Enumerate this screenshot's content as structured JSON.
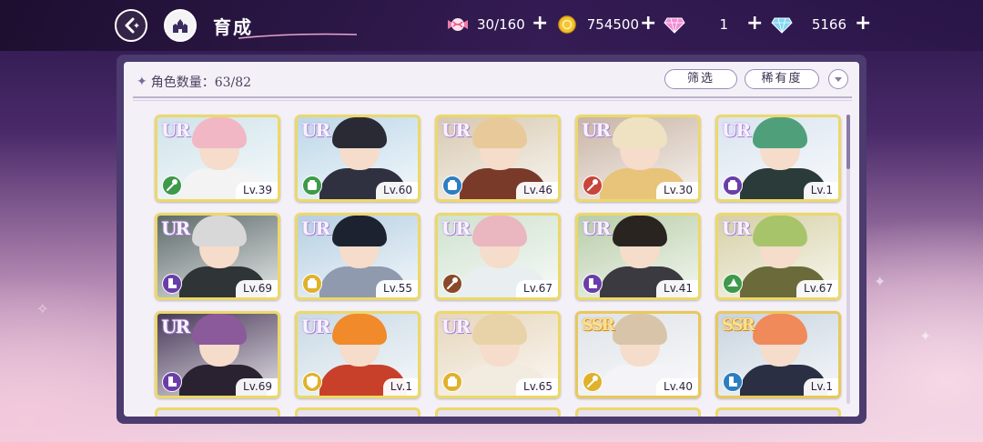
{
  "header": {
    "title": "育成",
    "resources": [
      {
        "icon": "candy-icon",
        "value": "30/160"
      },
      {
        "icon": "gold-coin-icon",
        "value": "754500"
      },
      {
        "icon": "pink-diamond-icon",
        "value": "1"
      },
      {
        "icon": "blue-diamond-icon",
        "value": "5166"
      }
    ]
  },
  "panel": {
    "count_label": "角色数量",
    "count_value": "：63/82",
    "filter_label": "筛选",
    "rarity_sort_label": "稀有度"
  },
  "cards": [
    {
      "rarity": "UR",
      "level": "Lv.39",
      "type_color": "#3e9a4a",
      "type_icon": "wand",
      "hair": "#f2b7c4",
      "bg": "#cfe3ea",
      "body": "#f3f3f3"
    },
    {
      "rarity": "UR",
      "level": "Lv.60",
      "type_color": "#3e9a4a",
      "type_icon": "fist",
      "hair": "#2a2a34",
      "bg": "#bcd7e8",
      "body": "#2f3140"
    },
    {
      "rarity": "UR",
      "level": "Lv.46",
      "type_color": "#2c7ec2",
      "type_icon": "fist",
      "hair": "#e8c99a",
      "bg": "#d7c9b0",
      "body": "#7a3a2a"
    },
    {
      "rarity": "UR",
      "level": "Lv.30",
      "type_color": "#c8453a",
      "type_icon": "wand",
      "hair": "#efe2c2",
      "bg": "#c9b4a4",
      "body": "#e7c47a"
    },
    {
      "rarity": "UR",
      "level": "Lv.1",
      "type_color": "#6a3ea8",
      "type_icon": "fist",
      "hair": "#4fa07a",
      "bg": "#d9e4ef",
      "body": "#2b3b3a"
    },
    {
      "rarity": "UR",
      "level": "Lv.69",
      "type_color": "#6a3ea8",
      "type_icon": "boot",
      "hair": "#d8d8d8",
      "bg": "#5d6a6a",
      "body": "#2f3436"
    },
    {
      "rarity": "UR",
      "level": "Lv.55",
      "type_color": "#e0b12a",
      "type_icon": "fist",
      "hair": "#1d2230",
      "bg": "#b5cfe2",
      "body": "#8f9aae"
    },
    {
      "rarity": "UR",
      "level": "Lv.67",
      "type_color": "#8a4a2a",
      "type_icon": "wand",
      "hair": "#eab6bf",
      "bg": "#cfe2cf",
      "body": "#e9eef0"
    },
    {
      "rarity": "UR",
      "level": "Lv.41",
      "type_color": "#6a3ea8",
      "type_icon": "boot",
      "hair": "#2a2420",
      "bg": "#b8cda8",
      "body": "#3a3a40"
    },
    {
      "rarity": "UR",
      "level": "Lv.67",
      "type_color": "#3e9a4a",
      "type_icon": "hat",
      "hair": "#a7c46a",
      "bg": "#d6d0a6",
      "body": "#6a6a3a"
    },
    {
      "rarity": "UR",
      "level": "Lv.69",
      "type_color": "#6a3ea8",
      "type_icon": "boot",
      "hair": "#8a5a9a",
      "bg": "#4a3a5a",
      "body": "#2a2230"
    },
    {
      "rarity": "UR",
      "level": "Lv.1",
      "type_color": "#e0b12a",
      "type_icon": "shield",
      "hair": "#f08a2a",
      "bg": "#c9d9e4",
      "body": "#c8402a"
    },
    {
      "rarity": "UR",
      "level": "Lv.65",
      "type_color": "#e0b12a",
      "type_icon": "fist",
      "hair": "#e8d2a8",
      "bg": "#e6d6bc",
      "body": "#f2ece0"
    },
    {
      "rarity": "SSR",
      "level": "Lv.40",
      "type_color": "#e0b12a",
      "type_icon": "wand",
      "hair": "#d8c4a8",
      "bg": "#dfe3e8",
      "body": "#f4f4f8"
    },
    {
      "rarity": "SSR",
      "level": "Lv.1",
      "type_color": "#2c7ec2",
      "type_icon": "boot",
      "hair": "#f08a5a",
      "bg": "#c8d4e0",
      "body": "#2a2f44"
    }
  ]
}
